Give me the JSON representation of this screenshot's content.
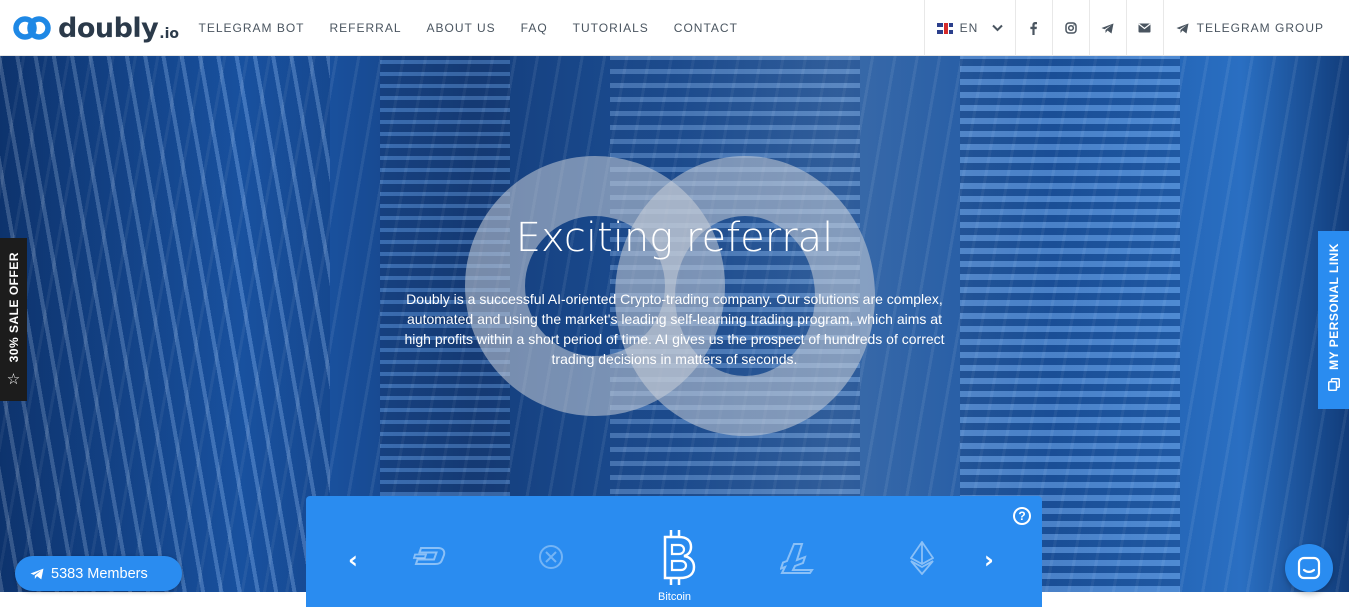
{
  "header": {
    "logo": {
      "name": "doubly",
      "suffix": ".io"
    },
    "nav": [
      "TELEGRAM BOT",
      "REFERRAL",
      "ABOUT US",
      "FAQ",
      "TUTORIALS",
      "CONTACT"
    ],
    "language": "EN",
    "social_icons": [
      "facebook-icon",
      "instagram-icon",
      "telegram-icon",
      "mail-icon"
    ],
    "telegram_group": "TELEGRAM GROUP"
  },
  "hero": {
    "title": "Exciting referral",
    "description": "Doubly is a successful AI-oriented Crypto-trading company. Our solutions are complex, automated and using the market's leading self-learning trading program, which aims at high profits within a short period of time. AI gives us the prospect of hundreds of correct trading decisions in matters of seconds."
  },
  "side_tabs": {
    "sale": "30% SALE OFFER",
    "personal_link": "MY PERSONAL LINK"
  },
  "carousel": {
    "coins": [
      "dash-icon",
      "ripple-icon",
      "bitcoin-icon",
      "litecoin-icon",
      "ethereum-icon"
    ],
    "selected_label": "Bitcoin",
    "help": "?"
  },
  "members": {
    "label": "5383 Members"
  },
  "colors": {
    "accent": "#2a8cf0",
    "dark": "#1c1c1c",
    "logo": "#1e88e5"
  }
}
